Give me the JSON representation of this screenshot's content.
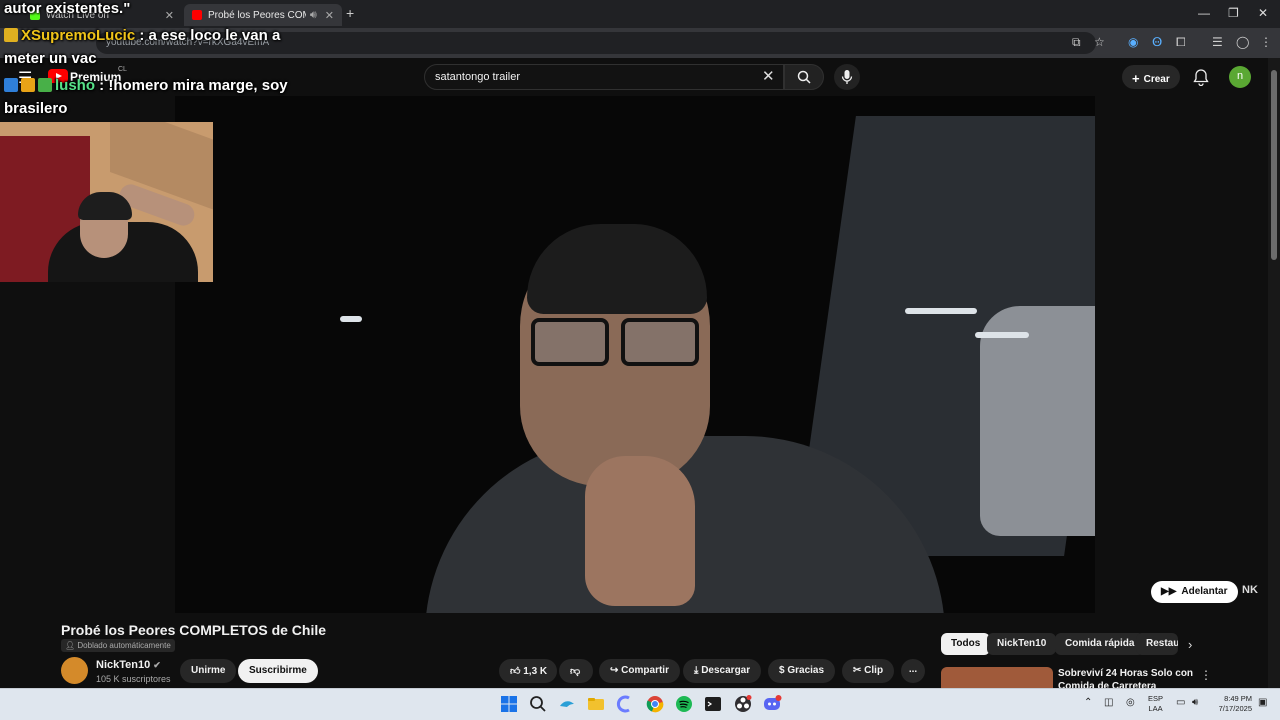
{
  "browser": {
    "tabs": [
      {
        "title": "Watch Live on",
        "active": false
      },
      {
        "title": "Probé los Peores COMPLETO",
        "active": true
      }
    ],
    "new_tab": "+",
    "url": "youtube.com/watch?v=rkXGa4vEmA"
  },
  "youtube": {
    "logo_label": "Premium",
    "country": "CL",
    "search": {
      "value": "satantongo trailer"
    },
    "create_label": "Crear",
    "user_initial": "n",
    "skip_label": "Adelantar",
    "skip_brand": "NK"
  },
  "chat": {
    "top_fragment": "autor existentes.\"",
    "messages": [
      {
        "user": "XSupremoLucic",
        "line1": "a ese loco le van a",
        "line2": "meter un vac"
      },
      {
        "user": "lusho",
        "line1": "!homero mira marge, soy",
        "line2": "brasilero"
      }
    ]
  },
  "video": {
    "title": "Probé los Peores COMPLETOS de Chile",
    "dubbed_label": "Doblado automáticamente",
    "channel": {
      "name": "NickTen10",
      "subscribers": "105 K suscriptores"
    },
    "join_label": "Unirme",
    "subscribe_label": "Suscribirme",
    "likes": "1,3 K",
    "share_label": "Compartir",
    "download_label": "Descargar",
    "thanks_label": "Gracias",
    "clip_label": "Clip",
    "more_label": "..."
  },
  "chips": [
    "Todos",
    "NickTen10",
    "Comida rápida",
    "Restau"
  ],
  "recommendation": {
    "title": "Sobreviví 24 Horas Solo con Comida de Carretera"
  },
  "taskbar": {
    "lang_top": "ESP",
    "lang_bottom": "LAA",
    "time": "8:49 PM",
    "date": "7/17/2025"
  },
  "colors": {
    "youtube_red": "#ff0000",
    "page_bg": "#0f0f0f",
    "chat_user1": "#f0c419",
    "chat_user2": "#57e389",
    "avatar_green": "#5aa833",
    "taskbar_bg": "#dfe6ee"
  }
}
